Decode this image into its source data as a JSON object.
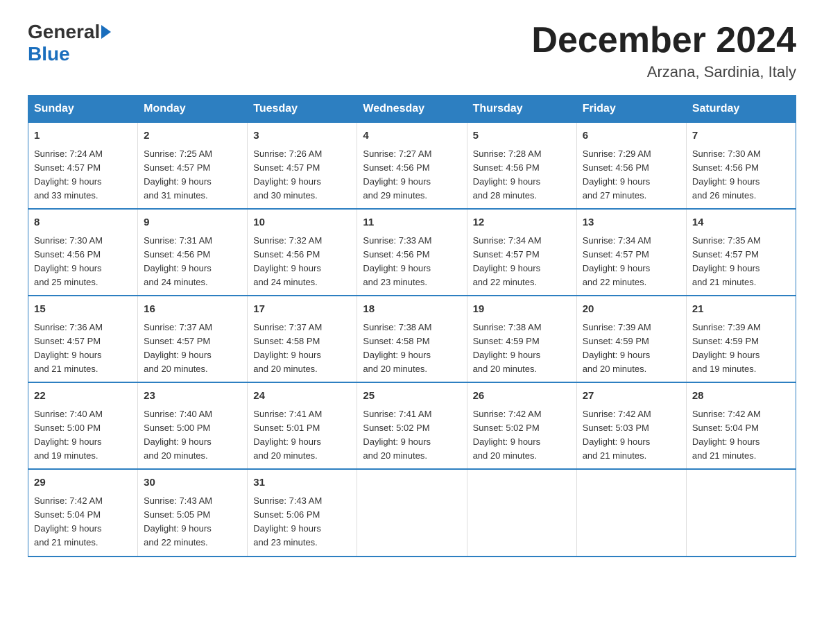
{
  "header": {
    "logo_general": "General",
    "logo_blue": "Blue",
    "title": "December 2024",
    "subtitle": "Arzana, Sardinia, Italy"
  },
  "days_of_week": [
    "Sunday",
    "Monday",
    "Tuesday",
    "Wednesday",
    "Thursday",
    "Friday",
    "Saturday"
  ],
  "weeks": [
    [
      {
        "num": "1",
        "sunrise": "7:24 AM",
        "sunset": "4:57 PM",
        "daylight": "9 hours and 33 minutes."
      },
      {
        "num": "2",
        "sunrise": "7:25 AM",
        "sunset": "4:57 PM",
        "daylight": "9 hours and 31 minutes."
      },
      {
        "num": "3",
        "sunrise": "7:26 AM",
        "sunset": "4:57 PM",
        "daylight": "9 hours and 30 minutes."
      },
      {
        "num": "4",
        "sunrise": "7:27 AM",
        "sunset": "4:56 PM",
        "daylight": "9 hours and 29 minutes."
      },
      {
        "num": "5",
        "sunrise": "7:28 AM",
        "sunset": "4:56 PM",
        "daylight": "9 hours and 28 minutes."
      },
      {
        "num": "6",
        "sunrise": "7:29 AM",
        "sunset": "4:56 PM",
        "daylight": "9 hours and 27 minutes."
      },
      {
        "num": "7",
        "sunrise": "7:30 AM",
        "sunset": "4:56 PM",
        "daylight": "9 hours and 26 minutes."
      }
    ],
    [
      {
        "num": "8",
        "sunrise": "7:30 AM",
        "sunset": "4:56 PM",
        "daylight": "9 hours and 25 minutes."
      },
      {
        "num": "9",
        "sunrise": "7:31 AM",
        "sunset": "4:56 PM",
        "daylight": "9 hours and 24 minutes."
      },
      {
        "num": "10",
        "sunrise": "7:32 AM",
        "sunset": "4:56 PM",
        "daylight": "9 hours and 24 minutes."
      },
      {
        "num": "11",
        "sunrise": "7:33 AM",
        "sunset": "4:56 PM",
        "daylight": "9 hours and 23 minutes."
      },
      {
        "num": "12",
        "sunrise": "7:34 AM",
        "sunset": "4:57 PM",
        "daylight": "9 hours and 22 minutes."
      },
      {
        "num": "13",
        "sunrise": "7:34 AM",
        "sunset": "4:57 PM",
        "daylight": "9 hours and 22 minutes."
      },
      {
        "num": "14",
        "sunrise": "7:35 AM",
        "sunset": "4:57 PM",
        "daylight": "9 hours and 21 minutes."
      }
    ],
    [
      {
        "num": "15",
        "sunrise": "7:36 AM",
        "sunset": "4:57 PM",
        "daylight": "9 hours and 21 minutes."
      },
      {
        "num": "16",
        "sunrise": "7:37 AM",
        "sunset": "4:57 PM",
        "daylight": "9 hours and 20 minutes."
      },
      {
        "num": "17",
        "sunrise": "7:37 AM",
        "sunset": "4:58 PM",
        "daylight": "9 hours and 20 minutes."
      },
      {
        "num": "18",
        "sunrise": "7:38 AM",
        "sunset": "4:58 PM",
        "daylight": "9 hours and 20 minutes."
      },
      {
        "num": "19",
        "sunrise": "7:38 AM",
        "sunset": "4:59 PM",
        "daylight": "9 hours and 20 minutes."
      },
      {
        "num": "20",
        "sunrise": "7:39 AM",
        "sunset": "4:59 PM",
        "daylight": "9 hours and 20 minutes."
      },
      {
        "num": "21",
        "sunrise": "7:39 AM",
        "sunset": "4:59 PM",
        "daylight": "9 hours and 19 minutes."
      }
    ],
    [
      {
        "num": "22",
        "sunrise": "7:40 AM",
        "sunset": "5:00 PM",
        "daylight": "9 hours and 19 minutes."
      },
      {
        "num": "23",
        "sunrise": "7:40 AM",
        "sunset": "5:00 PM",
        "daylight": "9 hours and 20 minutes."
      },
      {
        "num": "24",
        "sunrise": "7:41 AM",
        "sunset": "5:01 PM",
        "daylight": "9 hours and 20 minutes."
      },
      {
        "num": "25",
        "sunrise": "7:41 AM",
        "sunset": "5:02 PM",
        "daylight": "9 hours and 20 minutes."
      },
      {
        "num": "26",
        "sunrise": "7:42 AM",
        "sunset": "5:02 PM",
        "daylight": "9 hours and 20 minutes."
      },
      {
        "num": "27",
        "sunrise": "7:42 AM",
        "sunset": "5:03 PM",
        "daylight": "9 hours and 21 minutes."
      },
      {
        "num": "28",
        "sunrise": "7:42 AM",
        "sunset": "5:04 PM",
        "daylight": "9 hours and 21 minutes."
      }
    ],
    [
      {
        "num": "29",
        "sunrise": "7:42 AM",
        "sunset": "5:04 PM",
        "daylight": "9 hours and 21 minutes."
      },
      {
        "num": "30",
        "sunrise": "7:43 AM",
        "sunset": "5:05 PM",
        "daylight": "9 hours and 22 minutes."
      },
      {
        "num": "31",
        "sunrise": "7:43 AM",
        "sunset": "5:06 PM",
        "daylight": "9 hours and 23 minutes."
      },
      {
        "num": "",
        "sunrise": "",
        "sunset": "",
        "daylight": ""
      },
      {
        "num": "",
        "sunrise": "",
        "sunset": "",
        "daylight": ""
      },
      {
        "num": "",
        "sunrise": "",
        "sunset": "",
        "daylight": ""
      },
      {
        "num": "",
        "sunrise": "",
        "sunset": "",
        "daylight": ""
      }
    ]
  ]
}
